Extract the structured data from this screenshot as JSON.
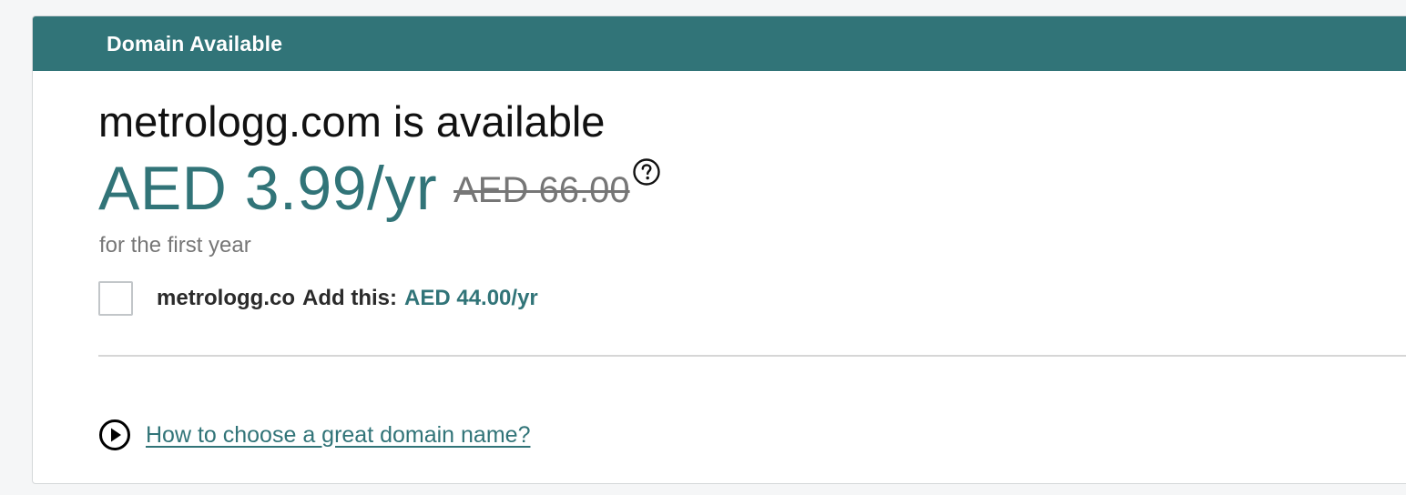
{
  "header": {
    "title": "Domain Available"
  },
  "result": {
    "headline": "metrologg.com is available",
    "price": "AED 3.99/yr",
    "original_price": "AED 66.00",
    "price_note": "for the first year"
  },
  "addon": {
    "checked": false,
    "domain": "metrologg.co",
    "label": "Add this:",
    "price": "AED 44.00/yr"
  },
  "help": {
    "link_text": "How to choose a great domain name?"
  },
  "icons": {
    "help": "question-circle-icon",
    "play": "play-circle-icon"
  },
  "colors": {
    "accent": "#317478",
    "header_bg": "#317478",
    "muted": "#767676"
  }
}
